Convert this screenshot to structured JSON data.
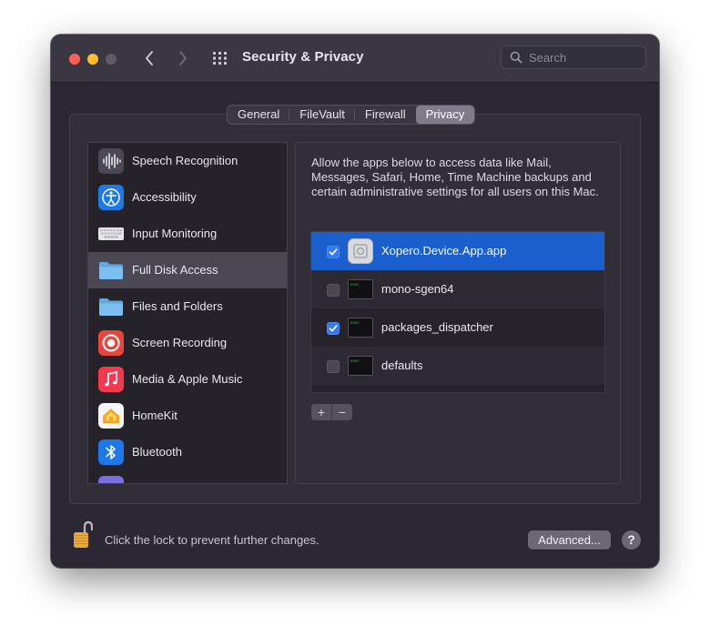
{
  "window": {
    "title": "Security & Privacy"
  },
  "search": {
    "placeholder": "Search"
  },
  "tabs": [
    {
      "label": "General",
      "active": false
    },
    {
      "label": "FileVault",
      "active": false
    },
    {
      "label": "Firewall",
      "active": false
    },
    {
      "label": "Privacy",
      "active": true
    }
  ],
  "sidebar": {
    "selected": "Full Disk Access",
    "items": [
      {
        "label": "Speech Recognition",
        "icon": "waveform-icon"
      },
      {
        "label": "Accessibility",
        "icon": "accessibility-icon"
      },
      {
        "label": "Input Monitoring",
        "icon": "keyboard-icon"
      },
      {
        "label": "Full Disk Access",
        "icon": "folder-icon"
      },
      {
        "label": "Files and Folders",
        "icon": "folder-icon"
      },
      {
        "label": "Screen Recording",
        "icon": "screen-recording-icon"
      },
      {
        "label": "Media & Apple Music",
        "icon": "music-note-icon"
      },
      {
        "label": "HomeKit",
        "icon": "home-icon"
      },
      {
        "label": "Bluetooth",
        "icon": "bluetooth-icon"
      }
    ]
  },
  "panel": {
    "description": "Allow the apps below to access data like Mail, Messages, Safari, Home, Time Machine backups and certain administrative settings for all users on this Mac.",
    "apps": [
      {
        "name": "Xopero.Device.App.app",
        "checked": true,
        "selected": true,
        "icon": "generic-app-icon"
      },
      {
        "name": "mono-sgen64",
        "checked": false,
        "selected": false,
        "icon": "terminal-exec-icon"
      },
      {
        "name": "packages_dispatcher",
        "checked": true,
        "selected": false,
        "icon": "terminal-exec-icon"
      },
      {
        "name": "defaults",
        "checked": false,
        "selected": false,
        "icon": "terminal-exec-icon"
      }
    ],
    "add_label": "+",
    "remove_label": "−"
  },
  "footer": {
    "lock_text": "Click the lock to prevent further changes.",
    "advanced_label": "Advanced...",
    "help_label": "?"
  },
  "colors": {
    "accent": "#3478f6",
    "selection": "#1a5fcc",
    "window_bg": "#2b2833"
  }
}
